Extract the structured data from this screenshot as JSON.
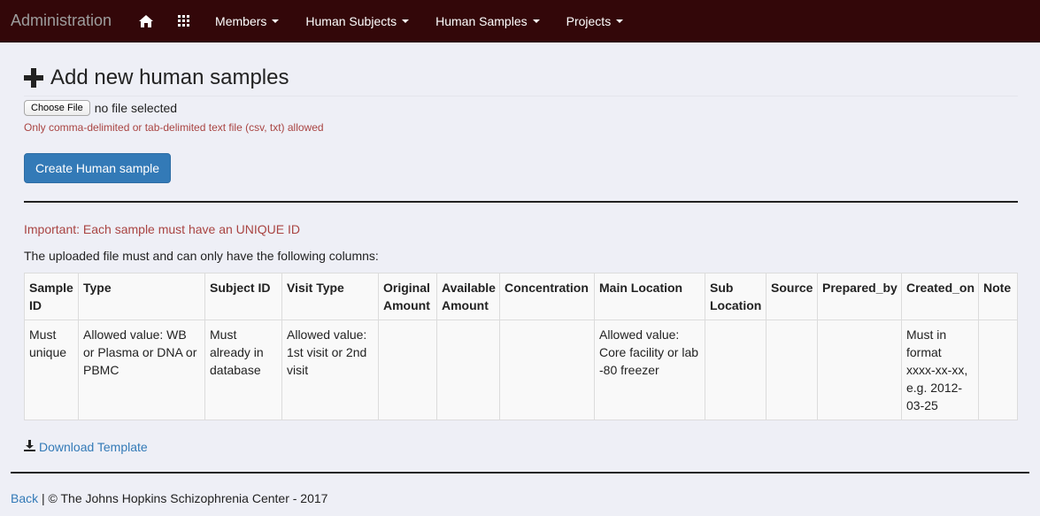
{
  "nav": {
    "brand": "Administration",
    "items": [
      {
        "label": "Members"
      },
      {
        "label": "Human Subjects"
      },
      {
        "label": "Human Samples"
      },
      {
        "label": "Projects"
      }
    ],
    "icons": [
      "home-icon",
      "apps-grid-icon"
    ],
    "colors": {
      "background": "#330709"
    }
  },
  "page": {
    "title": "Add new human samples",
    "file_input": {
      "button_label": "Choose File",
      "status": "no file selected"
    },
    "file_hint": "Only comma-delimited or tab-delimited text file (csv, txt) allowed",
    "submit_label": "Create Human sample",
    "important": "Important: Each sample must have an UNIQUE ID",
    "columns_note": "The uploaded file must and can only have the following columns:",
    "download_label": "Download Template"
  },
  "table": {
    "headers": [
      "Sample ID",
      "Type",
      "Subject ID",
      "Visit Type",
      "Original Amount",
      "Available Amount",
      "Concentration",
      "Main Location",
      "Sub Location",
      "Source",
      "Prepared_by",
      "Created_on",
      "Note"
    ],
    "row": [
      "Must unique",
      "Allowed value: WB or Plasma or DNA or PBMC",
      "Must already in database",
      "Allowed value: 1st visit or 2nd visit",
      "",
      "",
      "",
      "Allowed value: Core facility or lab -80 freezer",
      "",
      "",
      "",
      "Must in format xxxx-xx-xx, e.g. 2012-03-25",
      ""
    ]
  },
  "footer": {
    "back_label": "Back",
    "copyright": "| © The Johns Hopkins Schizophrenia Center - 2017"
  }
}
